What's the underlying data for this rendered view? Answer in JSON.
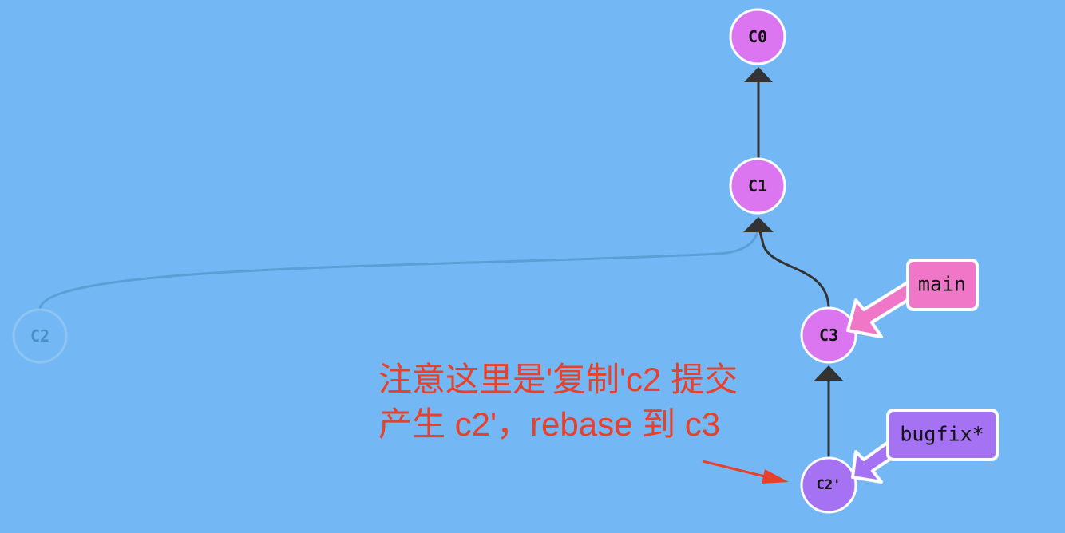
{
  "commits": [
    {
      "id": "c0",
      "label": "C0",
      "color": "#dc75f0"
    },
    {
      "id": "c1",
      "label": "C1",
      "color": "#dc75f0"
    },
    {
      "id": "c3",
      "label": "C3",
      "color": "#dc75f0"
    },
    {
      "id": "c2prime",
      "label": "C2'",
      "color": "#a572f3"
    },
    {
      "id": "c2ghost",
      "label": "C2",
      "color": "#73b8f4",
      "ghost": true
    }
  ],
  "branches": [
    {
      "id": "main",
      "label": "main",
      "color": "#f077c8",
      "target": "C3"
    },
    {
      "id": "bugfix",
      "label": "bugfix*",
      "color": "#a572f3",
      "target": "C2'"
    }
  ],
  "annotation": {
    "line1": "注意这里是'复制'c2 提交",
    "line2": "产生 c2'，rebase 到 c3",
    "color": "#e8402a"
  }
}
